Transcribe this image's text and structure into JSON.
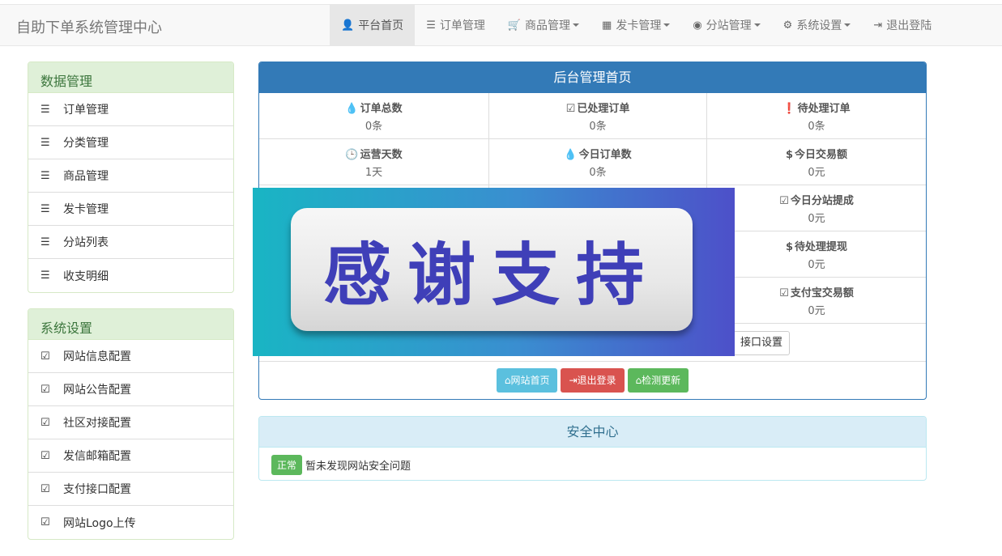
{
  "brand": "自助下单系统管理中心",
  "nav": [
    {
      "label": "平台首页",
      "icon": "👤",
      "icon_name": "user-icon",
      "active": true,
      "dropdown": false
    },
    {
      "label": "订单管理",
      "icon": "☰",
      "icon_name": "list-icon",
      "active": false,
      "dropdown": false
    },
    {
      "label": "商品管理",
      "icon": "🛒",
      "icon_name": "cart-icon",
      "active": false,
      "dropdown": true
    },
    {
      "label": "发卡管理",
      "icon": "▦",
      "icon_name": "grid-icon",
      "active": false,
      "dropdown": true
    },
    {
      "label": "分站管理",
      "icon": "◉",
      "icon_name": "globe-icon",
      "active": false,
      "dropdown": true
    },
    {
      "label": "系统设置",
      "icon": "⚙",
      "icon_name": "gear-icon",
      "active": false,
      "dropdown": true
    },
    {
      "label": "退出登陆",
      "icon": "⇥",
      "icon_name": "logout-icon",
      "active": false,
      "dropdown": false
    }
  ],
  "data_panel": {
    "title": "数据管理",
    "items": [
      "订单管理",
      "分类管理",
      "商品管理",
      "发卡管理",
      "分站列表",
      "收支明细"
    ]
  },
  "settings_panel": {
    "title": "系统设置",
    "items": [
      "网站信息配置",
      "网站公告配置",
      "社区对接配置",
      "发信邮箱配置",
      "支付接口配置",
      "网站Logo上传"
    ]
  },
  "main": {
    "title": "后台管理首页",
    "stats": [
      {
        "label": "订单总数",
        "value": "0条",
        "icon": "💧",
        "icon_name": "drop-icon"
      },
      {
        "label": "已处理订单",
        "value": "0条",
        "icon": "☑",
        "icon_name": "check-square-icon"
      },
      {
        "label": "待处理订单",
        "value": "0条",
        "icon": "❗",
        "icon_name": "exclamation-circle-icon"
      },
      {
        "label": "运营天数",
        "value": "1天",
        "icon": "🕒",
        "icon_name": "clock-icon"
      },
      {
        "label": "今日订单数",
        "value": "0条",
        "icon": "💧",
        "icon_name": "drop-icon"
      },
      {
        "label": "今日交易额",
        "value": "0元",
        "icon": "$",
        "icon_name": "dollar-icon"
      },
      {
        "label": "",
        "value": "",
        "icon": "",
        "icon_name": ""
      },
      {
        "label": "",
        "value": "",
        "icon": "",
        "icon_name": ""
      },
      {
        "label": "今日分站提成",
        "value": "0元",
        "icon": "☑",
        "icon_name": "check-square-icon"
      },
      {
        "label": "",
        "value": "",
        "icon": "",
        "icon_name": ""
      },
      {
        "label": "",
        "value": "",
        "icon": "",
        "icon_name": ""
      },
      {
        "label": "待处理提现",
        "value": "0元",
        "icon": "$",
        "icon_name": "dollar-icon"
      },
      {
        "label": "",
        "value": "",
        "icon": "",
        "icon_name": ""
      },
      {
        "label": "",
        "value": "",
        "icon": "",
        "icon_name": ""
      },
      {
        "label": "支付宝交易额",
        "value": "0元",
        "icon": "☑",
        "icon_name": "check-square-icon"
      }
    ],
    "link_button": "接口设置",
    "buttons": {
      "home": "网站首页",
      "logout": "退出登录",
      "update": "检测更新"
    }
  },
  "banner": {
    "text": "感谢支持"
  },
  "security": {
    "title": "安全中心",
    "badge": "正常",
    "message": "暂未发现网站安全问题"
  }
}
